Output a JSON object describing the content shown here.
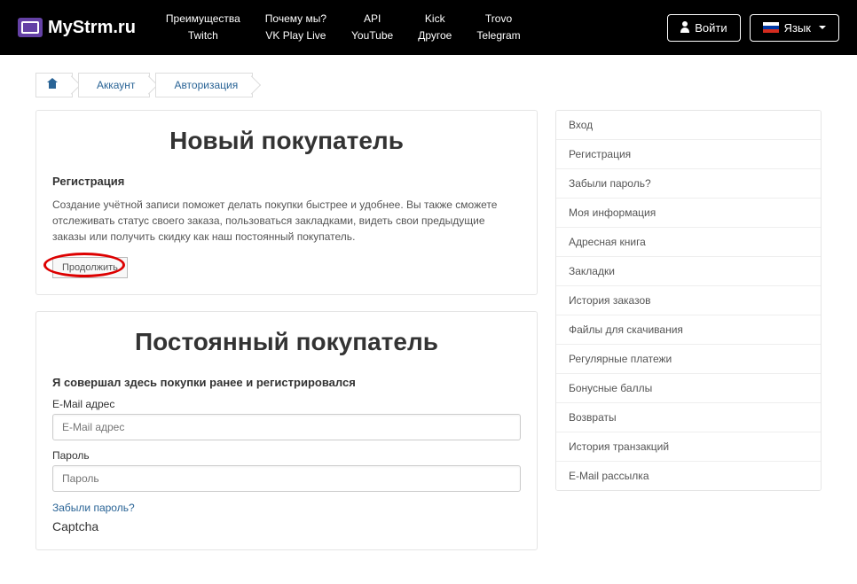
{
  "brand": "MyStrm.ru",
  "nav": [
    {
      "top": "Преимущества",
      "bottom": "Twitch"
    },
    {
      "top": "Почему мы?",
      "bottom": "VK Play Live"
    },
    {
      "top": "API",
      "bottom": "YouTube"
    },
    {
      "top": "Kick",
      "bottom": "Другое"
    },
    {
      "top": "Trovo",
      "bottom": "Telegram"
    }
  ],
  "login_btn": "Войти",
  "lang_label": "Язык",
  "breadcrumb": {
    "account": "Аккаунт",
    "auth": "Авторизация"
  },
  "new_customer": {
    "title": "Новый покупатель",
    "subtitle": "Регистрация",
    "desc": "Создание учётной записи поможет делать покупки быстрее и удобнее. Вы также сможете отслеживать статус своего заказа, пользоваться закладками, видеть свои предыдущие заказы или получить скидку как наш постоянный покупатель.",
    "continue": "Продолжить"
  },
  "returning": {
    "title": "Постоянный покупатель",
    "subtitle": "Я совершал здесь покупки ранее и регистрировался",
    "email_label": "E-Mail адрес",
    "email_placeholder": "E-Mail адрес",
    "password_label": "Пароль",
    "password_placeholder": "Пароль",
    "forgot": "Забыли пароль?",
    "captcha": "Captcha"
  },
  "sidebar": [
    "Вход",
    "Регистрация",
    "Забыли пароль?",
    "Моя информация",
    "Адресная книга",
    "Закладки",
    "История заказов",
    "Файлы для скачивания",
    "Регулярные платежи",
    "Бонусные баллы",
    "Возвраты",
    "История транзакций",
    "E-Mail рассылка"
  ]
}
